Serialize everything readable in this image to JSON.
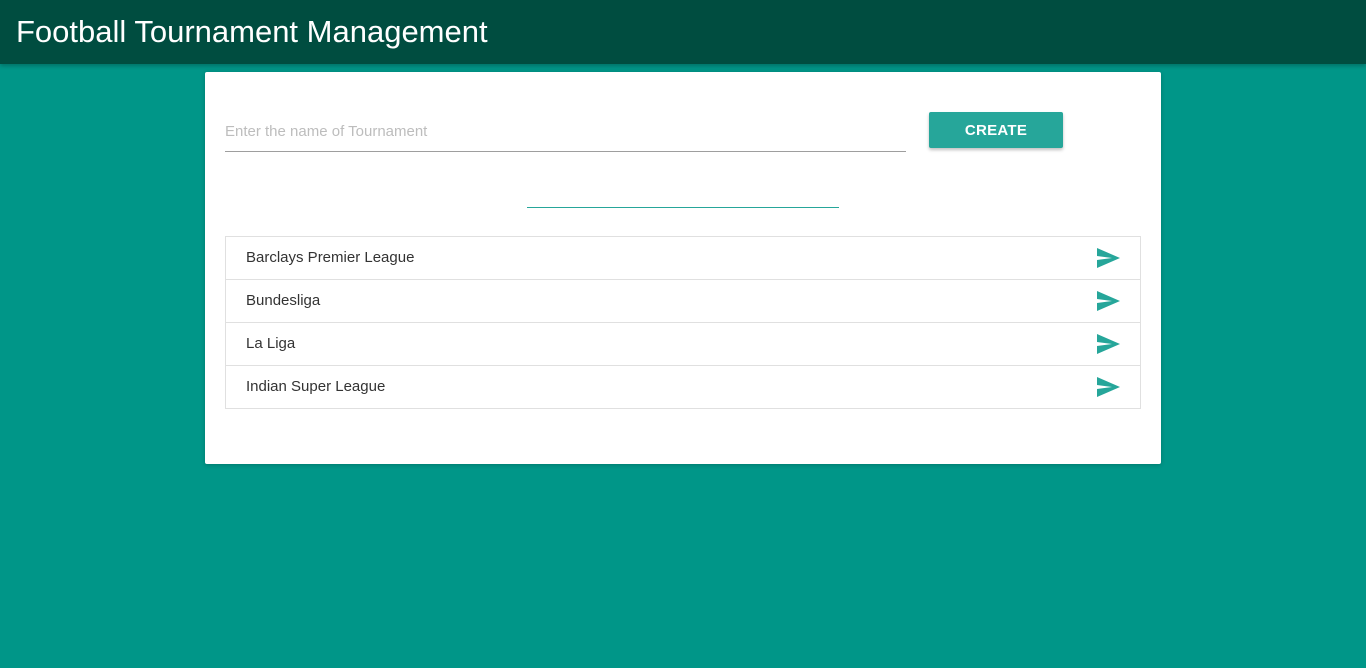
{
  "app": {
    "title": "Football Tournament Management"
  },
  "form": {
    "input_placeholder": "Enter the name of Tournament",
    "input_value": "",
    "create_label": "CREATE"
  },
  "tournaments": [
    {
      "name": "Barclays Premier League",
      "action_icon": "send-icon"
    },
    {
      "name": "Bundesliga",
      "action_icon": "send-icon"
    },
    {
      "name": "La Liga",
      "action_icon": "send-icon"
    },
    {
      "name": "Indian Super League",
      "action_icon": "send-icon"
    }
  ],
  "colors": {
    "background": "#009688",
    "appbar": "#004d40",
    "accent": "#26a69a",
    "card": "#ffffff"
  }
}
